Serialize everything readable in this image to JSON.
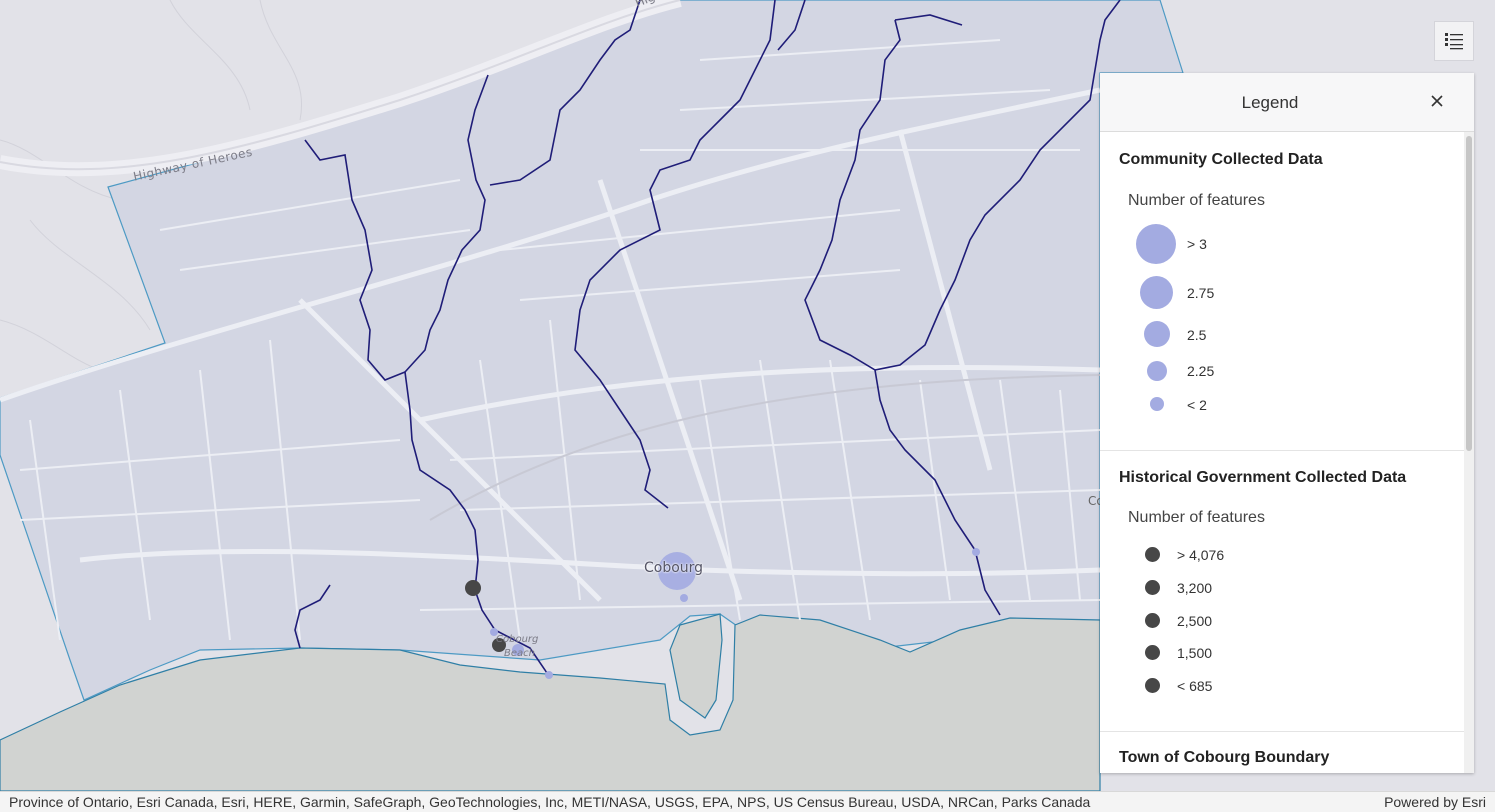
{
  "map": {
    "highway_label": "Highway of Heroes",
    "highway_label_2": "Hig",
    "town_label": "Cobourg",
    "beach_label_1": "Cobourg",
    "beach_label_2": "Beach",
    "edge_label": "Co"
  },
  "legend_toggle": {
    "icon": "legend-list-icon"
  },
  "legend": {
    "title": "Legend",
    "close_icon": "close-icon",
    "sections": [
      {
        "title": "Community Collected Data",
        "subtitle": "Number of features",
        "color": "#a3abe1",
        "items": [
          {
            "label": "> 3"
          },
          {
            "label": "2.75"
          },
          {
            "label": "2.5"
          },
          {
            "label": "2.25"
          },
          {
            "label": "< 2"
          }
        ]
      },
      {
        "title": "Historical Government Collected Data",
        "subtitle": "Number of features",
        "color": "#474747",
        "items": [
          {
            "label": "> 4,076"
          },
          {
            "label": "3,200"
          },
          {
            "label": "2,500"
          },
          {
            "label": "1,500"
          },
          {
            "label": "< 685"
          }
        ]
      },
      {
        "title": "Town of Cobourg Boundary"
      }
    ]
  },
  "attribution": {
    "text": "Province of Ontario, Esri Canada, Esri, HERE, Garmin, SafeGraph, GeoTechnologies, Inc, METI/NASA, USGS, EPA, NPS, US Census Bureau, USDA, NRCan, Parks Canada",
    "powered_by": "Powered by Esri"
  },
  "colors": {
    "land": "#e2e2e8",
    "town_fill": "#d3d6e3",
    "lake": "#d1d3d1",
    "stream": "#1f1d78",
    "boundary": "#4d9ac4",
    "road": "#f1f1f5"
  }
}
